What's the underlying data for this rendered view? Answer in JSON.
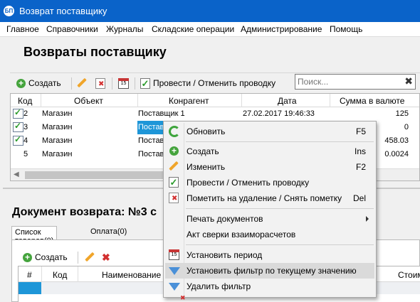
{
  "window": {
    "title": "Возврат поставщику",
    "icon": "БП"
  },
  "menu": [
    "Главное",
    "Справочники",
    "Журналы",
    "Складские операции",
    "Администрирование",
    "Помощь"
  ],
  "page_title": "Возвраты поставщику",
  "toolbar": {
    "create_label": "Создать",
    "post_label": "Провести / Отменить проводку",
    "search_placeholder": "Поиск...",
    "calendar_text": "15"
  },
  "grid": {
    "columns": [
      "Код",
      "Объект",
      "Конрагент",
      "Дата",
      "Сумма в валюте"
    ],
    "rows": [
      {
        "code": "2",
        "object": "Магазин",
        "counterparty": "Поставщик 1",
        "date": "27.02.2017 19:46:33",
        "sum": "125",
        "posted": true
      },
      {
        "code": "3",
        "object": "Магазин",
        "counterparty": "Постав",
        "date": "",
        "sum": "0",
        "posted": true
      },
      {
        "code": "4",
        "object": "Магазин",
        "counterparty": "Постав",
        "date": "",
        "sum": "458.03",
        "posted": true
      },
      {
        "code": "5",
        "object": "Магазин",
        "counterparty": "Постав",
        "date": "",
        "sum": "0.0024",
        "posted": false
      }
    ]
  },
  "document": {
    "title": "Документ возврата: №3 с",
    "tabs": [
      "Список товаров(0)",
      "Оплата(0)"
    ],
    "create_label": "Создать",
    "columns": [
      "#",
      "Код",
      "Наименование",
      "Стоим"
    ]
  },
  "context_menu": {
    "items": [
      {
        "label": "Обновить",
        "shortcut": "F5",
        "icon": "refresh-icon"
      },
      {
        "label": "Создать",
        "shortcut": "Ins",
        "icon": "plus-icon"
      },
      {
        "label": "Изменить",
        "shortcut": "F2",
        "icon": "pencil-icon"
      },
      {
        "label": "Провести / Отменить проводку",
        "shortcut": "",
        "icon": "check-icon"
      },
      {
        "label": "Пометить на удаление / Снять пометку",
        "shortcut": "Del",
        "icon": "delete-icon"
      },
      {
        "label": "Печать документов",
        "shortcut": "",
        "icon": ""
      },
      {
        "label": "Акт сверки взаиморасчетов",
        "shortcut": "",
        "icon": ""
      },
      {
        "label": "Установить период",
        "shortcut": "",
        "icon": "calendar-icon"
      },
      {
        "label": "Установить фильтр по текущему значению",
        "shortcut": "",
        "icon": "funnel-icon"
      },
      {
        "label": "Удалить фильтр",
        "shortcut": "",
        "icon": "funnel-remove-icon"
      }
    ]
  },
  "colors": {
    "titlebar": "#0a63c9",
    "selection": "#1e96d8",
    "accent_green": "#45a43d"
  }
}
